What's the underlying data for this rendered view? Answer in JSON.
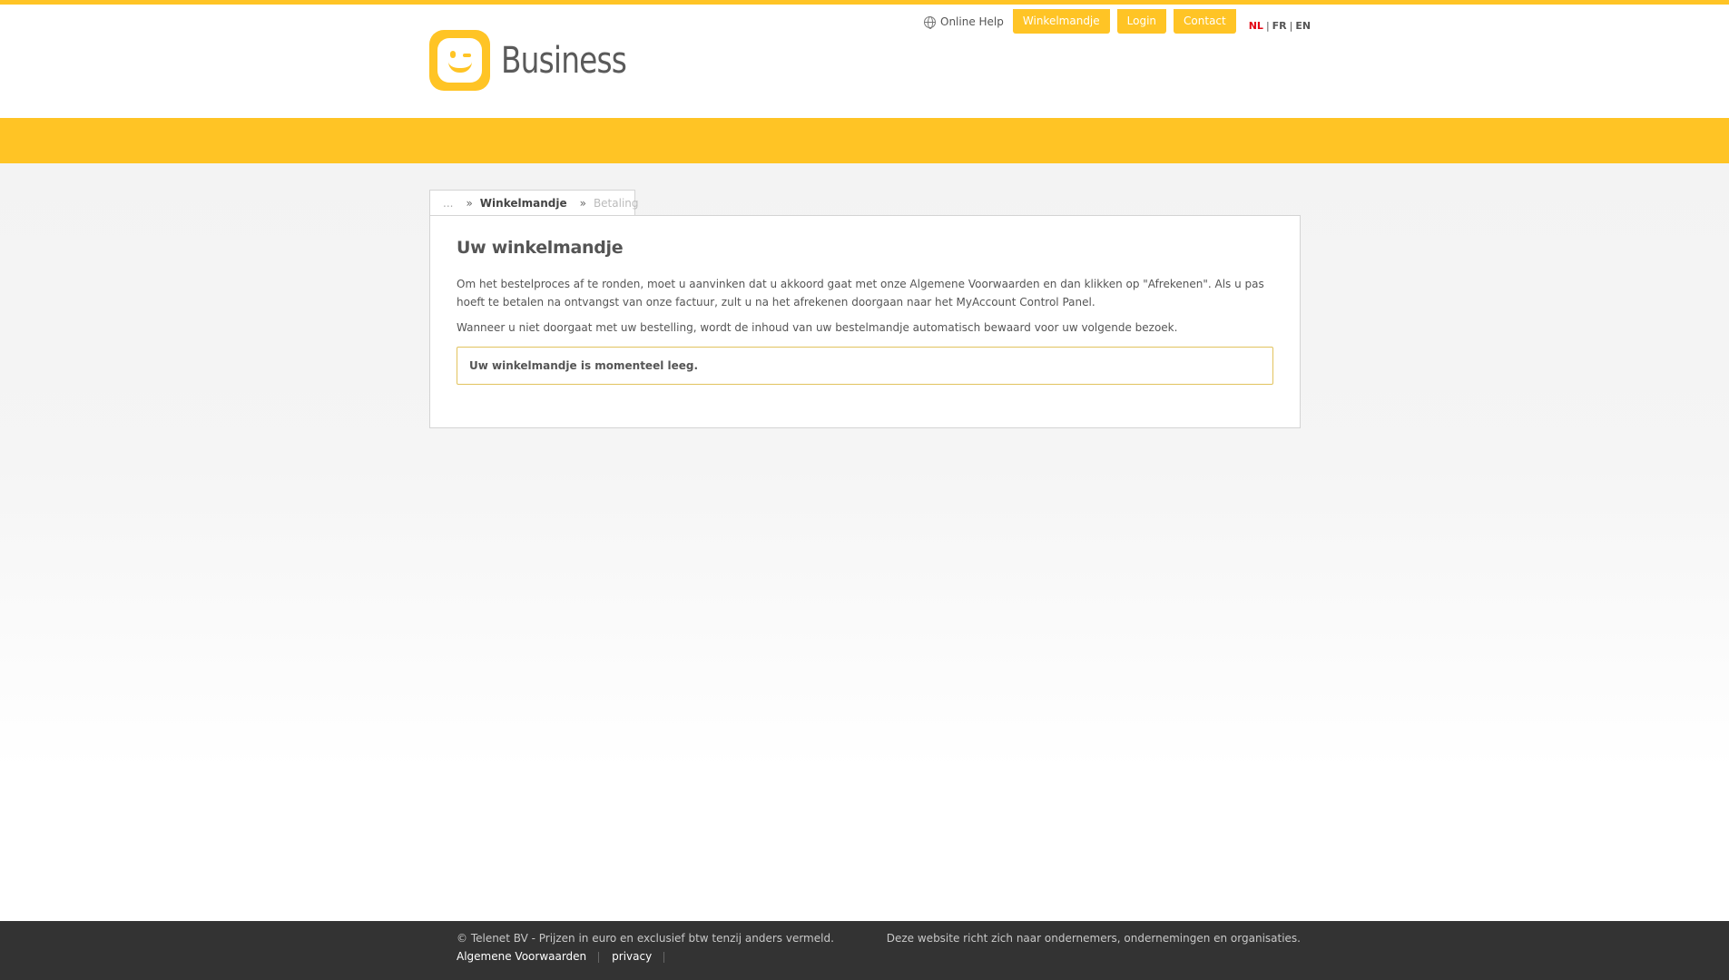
{
  "header": {
    "logo_text": "Business",
    "help_label": "Online Help",
    "nav": [
      "Winkelmandje",
      "Login",
      "Contact"
    ],
    "languages": [
      "NL",
      "FR",
      "EN"
    ],
    "active_language": "NL"
  },
  "breadcrumb": {
    "ellipsis": "...",
    "separator": "»",
    "current": "Winkelmandje",
    "next": "Betaling"
  },
  "main": {
    "title": "Uw winkelmandje",
    "paragraph1": "Om het bestelproces af te ronden, moet u aanvinken dat u akkoord gaat met onze Algemene Voorwaarden en dan klikken op \"Afrekenen\". Als u pas hoeft te betalen na ontvangst van onze factuur, zult u na het afrekenen doorgaan naar het MyAccount Control Panel.",
    "paragraph2": "Wanneer u niet doorgaat met uw bestelling, wordt de inhoud van uw bestelmandje automatisch bewaard voor uw volgende bezoek.",
    "empty_message": "Uw winkelmandje is momenteel leeg."
  },
  "footer": {
    "copyright": "© Telenet BV - Prijzen in euro en exclusief btw tenzij anders vermeld.",
    "notice": "Deze website richt zich naar ondernemers, ondernemingen en organisaties.",
    "links": [
      "Algemene Voorwaarden",
      "privacy"
    ]
  },
  "colors": {
    "brand_yellow": "#ffc425",
    "footer_bg": "#333333",
    "active_language": "#e30613"
  }
}
